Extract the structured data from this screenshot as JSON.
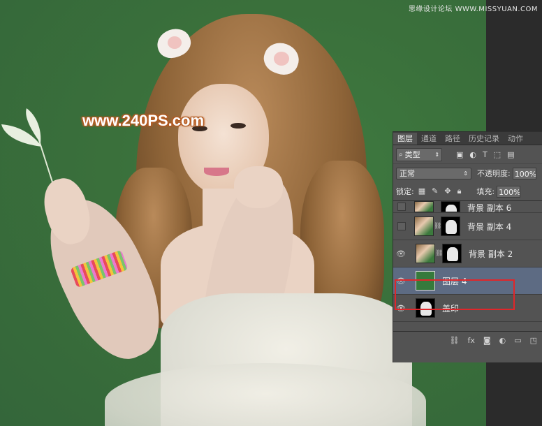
{
  "watermark_top": "思缘设计论坛 WWW.MISSYUAN.COM",
  "watermark_main": "www.240PS.com",
  "layers_panel": {
    "tabs": [
      "图层",
      "通道",
      "路径",
      "历史记录",
      "动作"
    ],
    "filter_kind": "类型",
    "blend_mode": "正常",
    "opacity_label": "不透明度:",
    "opacity_value": "100%",
    "lock_label": "锁定:",
    "fill_label": "填充:",
    "fill_value": "100%",
    "layers": [
      {
        "name": "背景 副本 6",
        "visible": false
      },
      {
        "name": "背景 副本 4",
        "visible": false
      },
      {
        "name": "背景 副本 2",
        "visible": true
      },
      {
        "name": "图层 4",
        "visible": true,
        "selected": true
      },
      {
        "name": "盖印",
        "visible": true
      }
    ]
  },
  "colors": {
    "canvas_background": "#386b3a",
    "selection_outline": "#e0262a",
    "layer4_fill": "#367a3c"
  }
}
